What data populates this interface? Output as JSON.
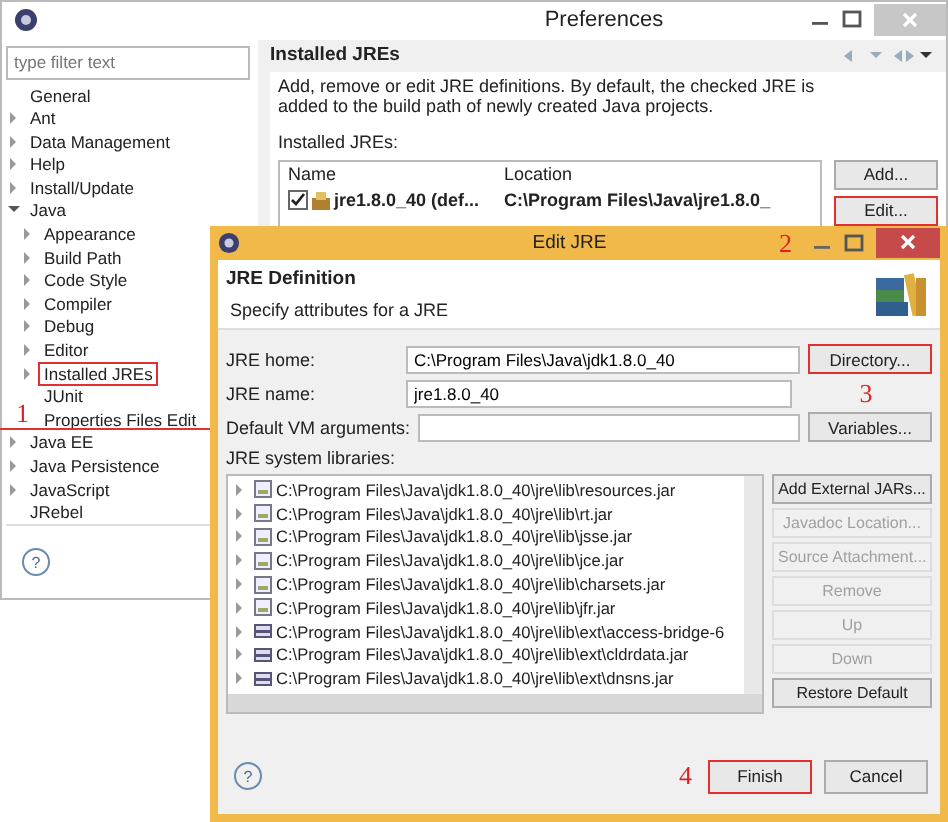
{
  "preferences": {
    "title": "Preferences",
    "filter_placeholder": "type filter text",
    "tree": [
      {
        "label": "General",
        "kind": "leaf",
        "annotated": false
      },
      {
        "label": "Ant",
        "kind": "collapsed",
        "annotated": false
      },
      {
        "label": "Data Management",
        "kind": "collapsed",
        "annotated": false
      },
      {
        "label": "Help",
        "kind": "collapsed",
        "annotated": false
      },
      {
        "label": "Install/Update",
        "kind": "collapsed",
        "annotated": false
      },
      {
        "label": "Java",
        "kind": "expanded",
        "annotated": false,
        "children": [
          {
            "label": "Appearance",
            "kind": "collapsed",
            "annotated": false
          },
          {
            "label": "Build Path",
            "kind": "collapsed",
            "annotated": false
          },
          {
            "label": "Code Style",
            "kind": "collapsed",
            "annotated": false
          },
          {
            "label": "Compiler",
            "kind": "collapsed",
            "annotated": false
          },
          {
            "label": "Debug",
            "kind": "collapsed",
            "annotated": false
          },
          {
            "label": "Editor",
            "kind": "collapsed",
            "annotated": false
          },
          {
            "label": "Installed JREs",
            "kind": "collapsed",
            "annotated": true
          },
          {
            "label": "JUnit",
            "kind": "leaf",
            "annotated": false
          },
          {
            "label": "Properties Files Edit",
            "kind": "leaf",
            "annotated": false
          }
        ]
      },
      {
        "label": "Java EE",
        "kind": "collapsed",
        "annotated": false
      },
      {
        "label": "Java Persistence",
        "kind": "collapsed",
        "annotated": false
      },
      {
        "label": "JavaScript",
        "kind": "collapsed",
        "annotated": false
      },
      {
        "label": "JRebel",
        "kind": "leaf",
        "annotated": false
      }
    ],
    "help": "?",
    "page": {
      "heading": "Installed JREs",
      "description": "Add, remove or edit JRE definitions. By default, the checked JRE is added to the build path of newly created Java projects.",
      "list_label": "Installed JREs:",
      "columns": [
        "Name",
        "Location"
      ],
      "rows": [
        {
          "checked": true,
          "name": "jre1.8.0_40 (def...",
          "location": "C:\\Program Files\\Java\\jre1.8.0_"
        }
      ],
      "buttons": [
        {
          "label": "Add...",
          "annotated": false
        },
        {
          "label": "Edit...",
          "annotated": true
        }
      ]
    }
  },
  "dialog": {
    "title": "Edit JRE",
    "heading": "JRE Definition",
    "subtitle": "Specify attributes for a JRE",
    "fields": [
      {
        "label": "JRE home:",
        "value": "C:\\Program Files\\Java\\jdk1.8.0_40",
        "button": "Directory...",
        "annotated": true
      },
      {
        "label": "JRE name:",
        "value": "jre1.8.0_40"
      },
      {
        "label": "Default VM arguments:",
        "button": "Variables...",
        "annotated": false
      }
    ],
    "libraries_label": "JRE system libraries:",
    "libraries": [
      {
        "kind": "jar",
        "path": "C:\\Program Files\\Java\\jdk1.8.0_40\\jre\\lib\\resources.jar"
      },
      {
        "kind": "jar",
        "path": "C:\\Program Files\\Java\\jdk1.8.0_40\\jre\\lib\\rt.jar"
      },
      {
        "kind": "jar",
        "path": "C:\\Program Files\\Java\\jdk1.8.0_40\\jre\\lib\\jsse.jar"
      },
      {
        "kind": "jar",
        "path": "C:\\Program Files\\Java\\jdk1.8.0_40\\jre\\lib\\jce.jar"
      },
      {
        "kind": "jar",
        "path": "C:\\Program Files\\Java\\jdk1.8.0_40\\jre\\lib\\charsets.jar"
      },
      {
        "kind": "jar",
        "path": "C:\\Program Files\\Java\\jdk1.8.0_40\\jre\\lib\\jfr.jar"
      },
      {
        "kind": "ext",
        "path": "C:\\Program Files\\Java\\jdk1.8.0_40\\jre\\lib\\ext\\access-bridge-6"
      },
      {
        "kind": "ext",
        "path": "C:\\Program Files\\Java\\jdk1.8.0_40\\jre\\lib\\ext\\cldrdata.jar"
      },
      {
        "kind": "ext",
        "path": "C:\\Program Files\\Java\\jdk1.8.0_40\\jre\\lib\\ext\\dnsns.jar"
      }
    ],
    "side_buttons": [
      {
        "label": "Add External JARs...",
        "disabled": false
      },
      {
        "label": "Javadoc Location...",
        "disabled": true
      },
      {
        "label": "Source Attachment...",
        "disabled": true
      },
      {
        "label": "Remove",
        "disabled": true
      },
      {
        "label": "Up",
        "disabled": true
      },
      {
        "label": "Down",
        "disabled": true
      },
      {
        "label": "Restore Default",
        "disabled": false
      }
    ],
    "help": "?",
    "footer_buttons": [
      {
        "label": "Finish",
        "annotated": true
      },
      {
        "label": "Cancel",
        "annotated": false
      }
    ]
  },
  "annotations": [
    "1",
    "2",
    "3",
    "4"
  ]
}
